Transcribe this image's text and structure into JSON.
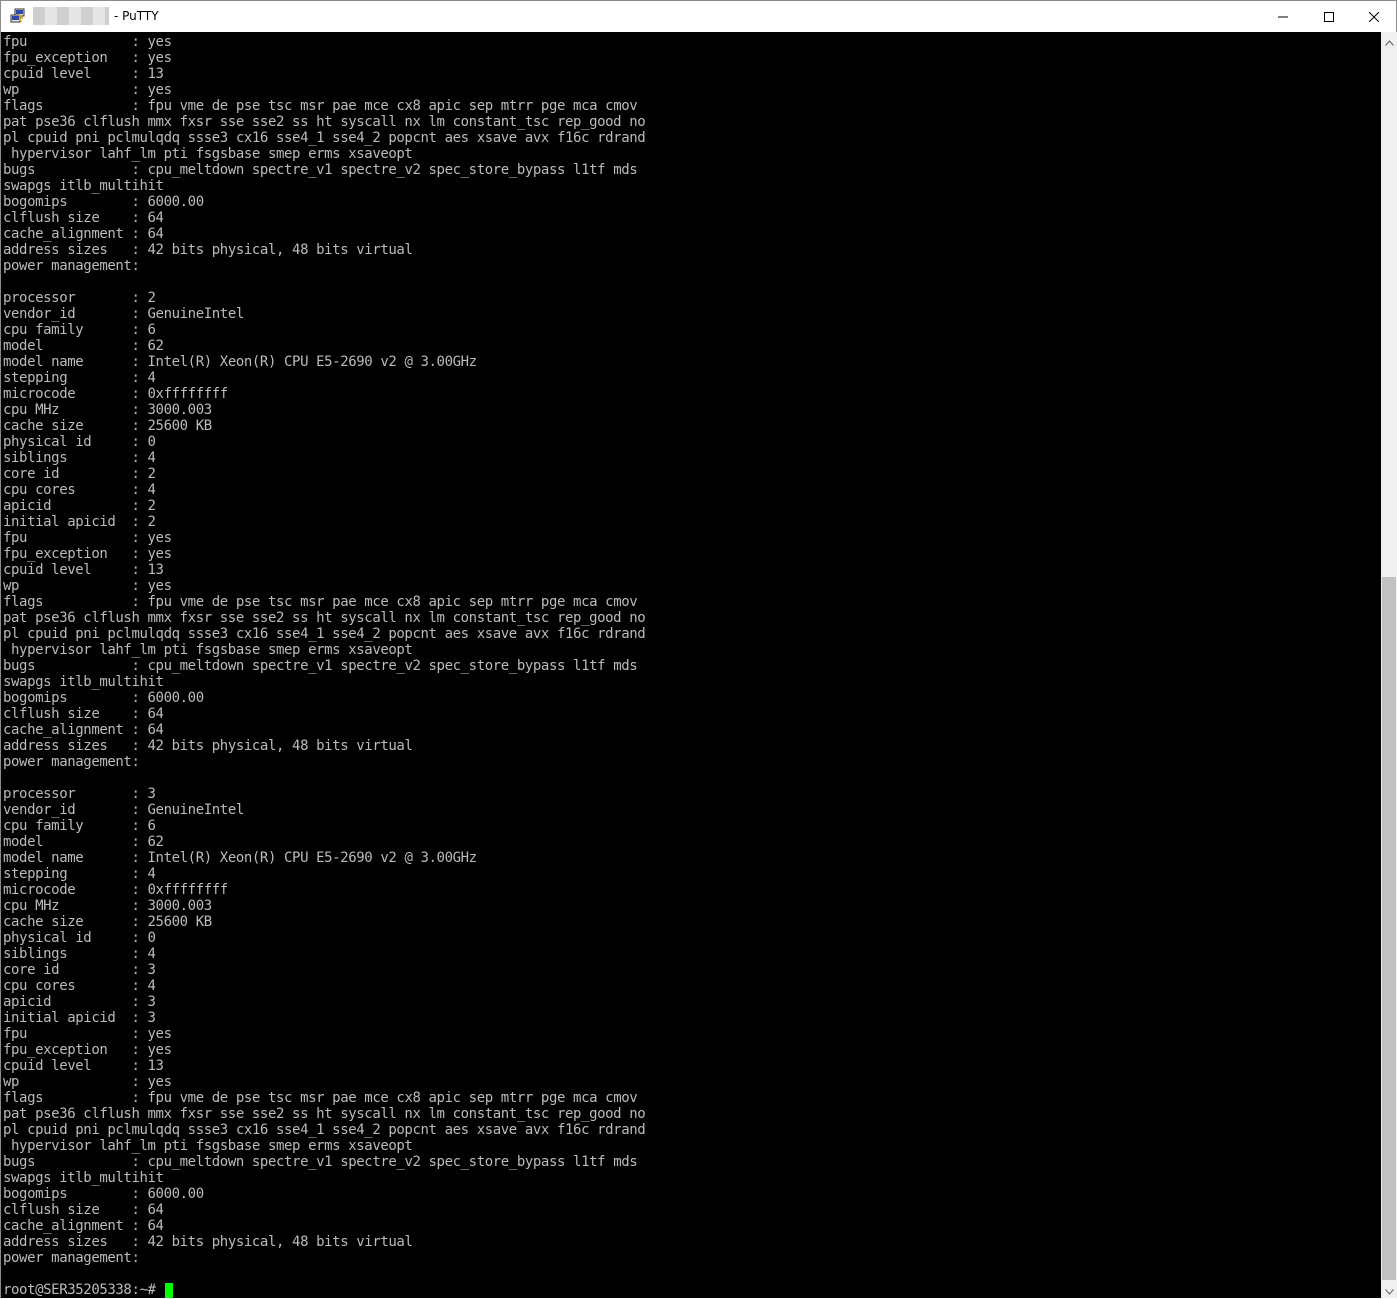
{
  "window": {
    "title": "- PuTTY",
    "controls": {
      "minimize": "minimize",
      "maximize": "maximize",
      "close": "close"
    }
  },
  "colors": {
    "terminal_bg": "#000000",
    "terminal_fg": "#bbbbbb",
    "cursor": "#00ff00",
    "scrollbar_track": "#f0f0f0",
    "scrollbar_thumb": "#c1c1c1"
  },
  "icons": {
    "app": "putty-icon",
    "scroll_up": "chevron-up-icon",
    "scroll_down": "chevron-down-icon"
  },
  "terminal": {
    "output": "fpu\t\t: yes\nfpu_exception\t: yes\ncpuid level\t: 13\nwp\t\t: yes\nflags\t\t: fpu vme de pse tsc msr pae mce cx8 apic sep mtrr pge mca cmov\npat pse36 clflush mmx fxsr sse sse2 ss ht syscall nx lm constant_tsc rep_good no\npl cpuid pni pclmulqdq ssse3 cx16 sse4_1 sse4_2 popcnt aes xsave avx f16c rdrand\n hypervisor lahf_lm pti fsgsbase smep erms xsaveopt\nbugs\t\t: cpu_meltdown spectre_v1 spectre_v2 spec_store_bypass l1tf mds\nswapgs itlb_multihit\nbogomips\t: 6000.00\nclflush size\t: 64\ncache_alignment\t: 64\naddress sizes\t: 42 bits physical, 48 bits virtual\npower management:\n\nprocessor\t: 2\nvendor_id\t: GenuineIntel\ncpu family\t: 6\nmodel\t\t: 62\nmodel name\t: Intel(R) Xeon(R) CPU E5-2690 v2 @ 3.00GHz\nstepping\t: 4\nmicrocode\t: 0xffffffff\ncpu MHz\t\t: 3000.003\ncache size\t: 25600 KB\nphysical id\t: 0\nsiblings\t: 4\ncore id\t\t: 2\ncpu cores\t: 4\napicid\t\t: 2\ninitial apicid\t: 2\nfpu\t\t: yes\nfpu_exception\t: yes\ncpuid level\t: 13\nwp\t\t: yes\nflags\t\t: fpu vme de pse tsc msr pae mce cx8 apic sep mtrr pge mca cmov\npat pse36 clflush mmx fxsr sse sse2 ss ht syscall nx lm constant_tsc rep_good no\npl cpuid pni pclmulqdq ssse3 cx16 sse4_1 sse4_2 popcnt aes xsave avx f16c rdrand\n hypervisor lahf_lm pti fsgsbase smep erms xsaveopt\nbugs\t\t: cpu_meltdown spectre_v1 spectre_v2 spec_store_bypass l1tf mds\nswapgs itlb_multihit\nbogomips\t: 6000.00\nclflush size\t: 64\ncache_alignment\t: 64\naddress sizes\t: 42 bits physical, 48 bits virtual\npower management:\n\nprocessor\t: 3\nvendor_id\t: GenuineIntel\ncpu family\t: 6\nmodel\t\t: 62\nmodel name\t: Intel(R) Xeon(R) CPU E5-2690 v2 @ 3.00GHz\nstepping\t: 4\nmicrocode\t: 0xffffffff\ncpu MHz\t\t: 3000.003\ncache size\t: 25600 KB\nphysical id\t: 0\nsiblings\t: 4\ncore id\t\t: 3\ncpu cores\t: 4\napicid\t\t: 3\ninitial apicid\t: 3\nfpu\t\t: yes\nfpu_exception\t: yes\ncpuid level\t: 13\nwp\t\t: yes\nflags\t\t: fpu vme de pse tsc msr pae mce cx8 apic sep mtrr pge mca cmov\npat pse36 clflush mmx fxsr sse sse2 ss ht syscall nx lm constant_tsc rep_good no\npl cpuid pni pclmulqdq ssse3 cx16 sse4_1 sse4_2 popcnt aes xsave avx f16c rdrand\n hypervisor lahf_lm pti fsgsbase smep erms xsaveopt\nbugs\t\t: cpu_meltdown spectre_v1 spectre_v2 spec_store_bypass l1tf mds\nswapgs itlb_multihit\nbogomips\t: 6000.00\nclflush size\t: 64\ncache_alignment\t: 64\naddress sizes\t: 42 bits physical, 48 bits virtual\npower management:\n",
    "prompt": "root@SER35205338:~# "
  }
}
